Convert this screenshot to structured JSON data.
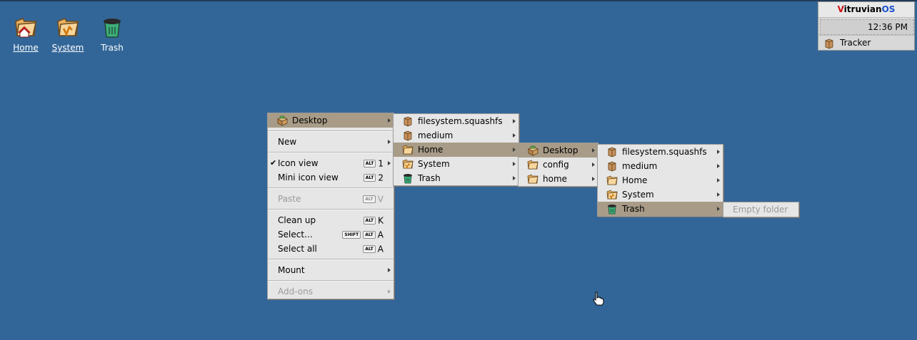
{
  "desktop": {
    "icons": [
      {
        "label": "Home"
      },
      {
        "label": "System"
      },
      {
        "label": "Trash"
      }
    ]
  },
  "deskbar": {
    "brand_prefix": "V",
    "brand_middle": "itruvian",
    "brand_suffix": "OS",
    "clock": "12:36 PM",
    "app": "Tracker"
  },
  "menu1": {
    "desktop": "Desktop",
    "new": "New",
    "icon_view": "Icon view",
    "icon_view_mod": "ALT",
    "icon_view_key": "1",
    "mini_icon_view": "Mini icon view",
    "mini_icon_view_mod": "ALT",
    "mini_icon_view_key": "2",
    "paste": "Paste",
    "paste_mod": "ALT",
    "paste_key": "V",
    "clean_up": "Clean up",
    "clean_up_mod": "ALT",
    "clean_up_key": "K",
    "select": "Select…",
    "select_mod1": "SHIFT",
    "select_mod2": "ALT",
    "select_key": "A",
    "select_all": "Select all",
    "select_all_mod": "ALT",
    "select_all_key": "A",
    "mount": "Mount",
    "addons": "Add-ons"
  },
  "menu2": {
    "items": [
      "filesystem.squashfs",
      "medium",
      "Home",
      "System",
      "Trash"
    ]
  },
  "menu3": {
    "items": [
      "Desktop",
      "config",
      "home"
    ]
  },
  "menu4": {
    "items": [
      "filesystem.squashfs",
      "medium",
      "Home",
      "System",
      "Trash"
    ]
  },
  "menu5": {
    "empty": "Empty folder"
  }
}
